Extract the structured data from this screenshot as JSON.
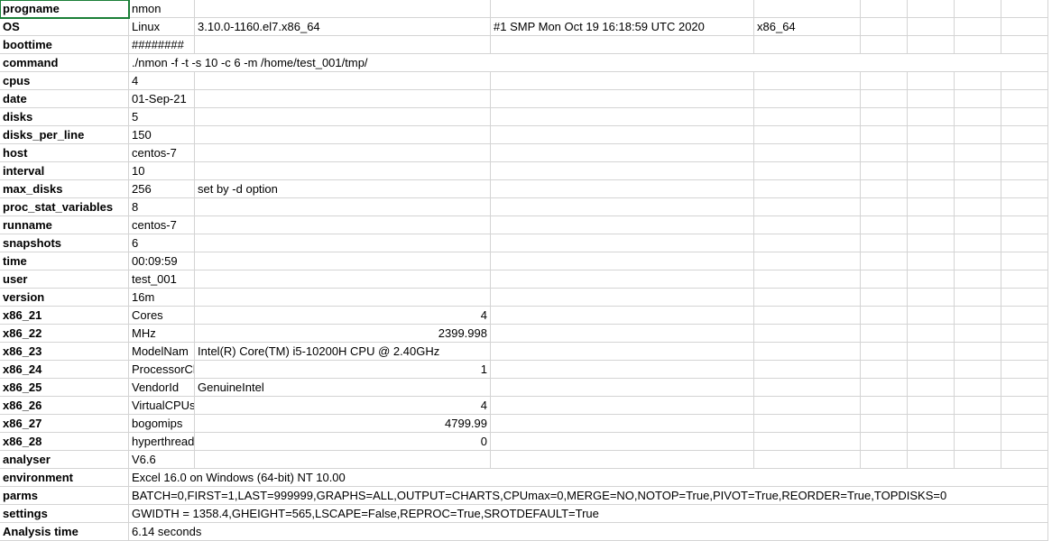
{
  "rows": [
    {
      "label": "progname",
      "cells": [
        "nmon",
        "",
        "",
        "",
        "",
        "",
        "",
        ""
      ]
    },
    {
      "label": "OS",
      "cells": [
        "Linux",
        "3.10.0-1160.el7.x86_64",
        "#1 SMP Mon Oct 19 16:18:59 UTC 2020",
        "x86_64",
        "",
        "",
        "",
        ""
      ]
    },
    {
      "label": "boottime",
      "cells": [
        "########",
        "",
        "",
        "",
        "",
        "",
        "",
        ""
      ]
    },
    {
      "label": "command",
      "cells_merged": "./nmon -f -t -s 10 -c 6 -m /home/test_001/tmp/"
    },
    {
      "label": "cpus",
      "cells": [
        "4",
        "",
        "",
        "",
        "",
        "",
        "",
        ""
      ]
    },
    {
      "label": "date",
      "cells": [
        "01-Sep-21",
        "",
        "",
        "",
        "",
        "",
        "",
        ""
      ]
    },
    {
      "label": "disks",
      "cells": [
        "5",
        "",
        "",
        "",
        "",
        "",
        "",
        ""
      ]
    },
    {
      "label": "disks_per_line",
      "cells": [
        "150",
        "",
        "",
        "",
        "",
        "",
        "",
        ""
      ]
    },
    {
      "label": "host",
      "cells": [
        "centos-7",
        "",
        "",
        "",
        "",
        "",
        "",
        ""
      ]
    },
    {
      "label": "interval",
      "cells": [
        "10",
        "",
        "",
        "",
        "",
        "",
        "",
        ""
      ]
    },
    {
      "label": "max_disks",
      "cells": [
        "256",
        "set by -d option",
        "",
        "",
        "",
        "",
        "",
        ""
      ]
    },
    {
      "label": "proc_stat_variables",
      "cells": [
        "8",
        "",
        "",
        "",
        "",
        "",
        "",
        ""
      ]
    },
    {
      "label": "runname",
      "cells": [
        "centos-7",
        "",
        "",
        "",
        "",
        "",
        "",
        ""
      ]
    },
    {
      "label": "snapshots",
      "cells": [
        "6",
        "",
        "",
        "",
        "",
        "",
        "",
        ""
      ]
    },
    {
      "label": "time",
      "cells": [
        "00:09:59",
        "",
        "",
        "",
        "",
        "",
        "",
        ""
      ]
    },
    {
      "label": "user",
      "cells": [
        "test_001",
        "",
        "",
        "",
        "",
        "",
        "",
        ""
      ]
    },
    {
      "label": "version",
      "cells": [
        "16m",
        "",
        "",
        "",
        "",
        "",
        "",
        ""
      ]
    },
    {
      "label": "x86_21",
      "cells": [
        "Cores",
        "4",
        "",
        "",
        "",
        "",
        "",
        ""
      ],
      "right_col": 2
    },
    {
      "label": "x86_22",
      "cells": [
        "MHz",
        "2399.998",
        "",
        "",
        "",
        "",
        "",
        ""
      ],
      "right_col": 2
    },
    {
      "label": "x86_23",
      "cells": [
        "ModelNam",
        "Intel(R) Core(TM) i5-10200H CPU @ 2.40GHz",
        "",
        "",
        "",
        "",
        "",
        ""
      ],
      "overflow_col": 2
    },
    {
      "label": "x86_24",
      "cells": [
        "ProcessorCh",
        "1",
        "",
        "",
        "",
        "",
        "",
        ""
      ],
      "right_col": 2
    },
    {
      "label": "x86_25",
      "cells": [
        "VendorId",
        "GenuineIntel",
        "",
        "",
        "",
        "",
        "",
        ""
      ]
    },
    {
      "label": "x86_26",
      "cells": [
        "VirtualCPUs",
        "4",
        "",
        "",
        "",
        "",
        "",
        ""
      ],
      "right_col": 2
    },
    {
      "label": "x86_27",
      "cells": [
        "bogomips",
        "4799.99",
        "",
        "",
        "",
        "",
        "",
        ""
      ],
      "right_col": 2
    },
    {
      "label": "x86_28",
      "cells": [
        "hyperthreads",
        "0",
        "",
        "",
        "",
        "",
        "",
        ""
      ],
      "right_col": 2
    },
    {
      "label": "analyser",
      "cells": [
        "V6.6",
        "",
        "",
        "",
        "",
        "",
        "",
        ""
      ]
    },
    {
      "label": "environment",
      "cells_merged": "Excel 16.0 on Windows (64-bit) NT 10.00"
    },
    {
      "label": "parms",
      "cells_merged": "BATCH=0,FIRST=1,LAST=999999,GRAPHS=ALL,OUTPUT=CHARTS,CPUmax=0,MERGE=NO,NOTOP=True,PIVOT=True,REORDER=True,TOPDISKS=0"
    },
    {
      "label": "settings",
      "cells_merged": "GWIDTH = 1358.4,GHEIGHT=565,LSCAPE=False,REPROC=True,SROTDEFAULT=True"
    },
    {
      "label": "Analysis time",
      "cells_merged": "6.14 seconds"
    }
  ]
}
